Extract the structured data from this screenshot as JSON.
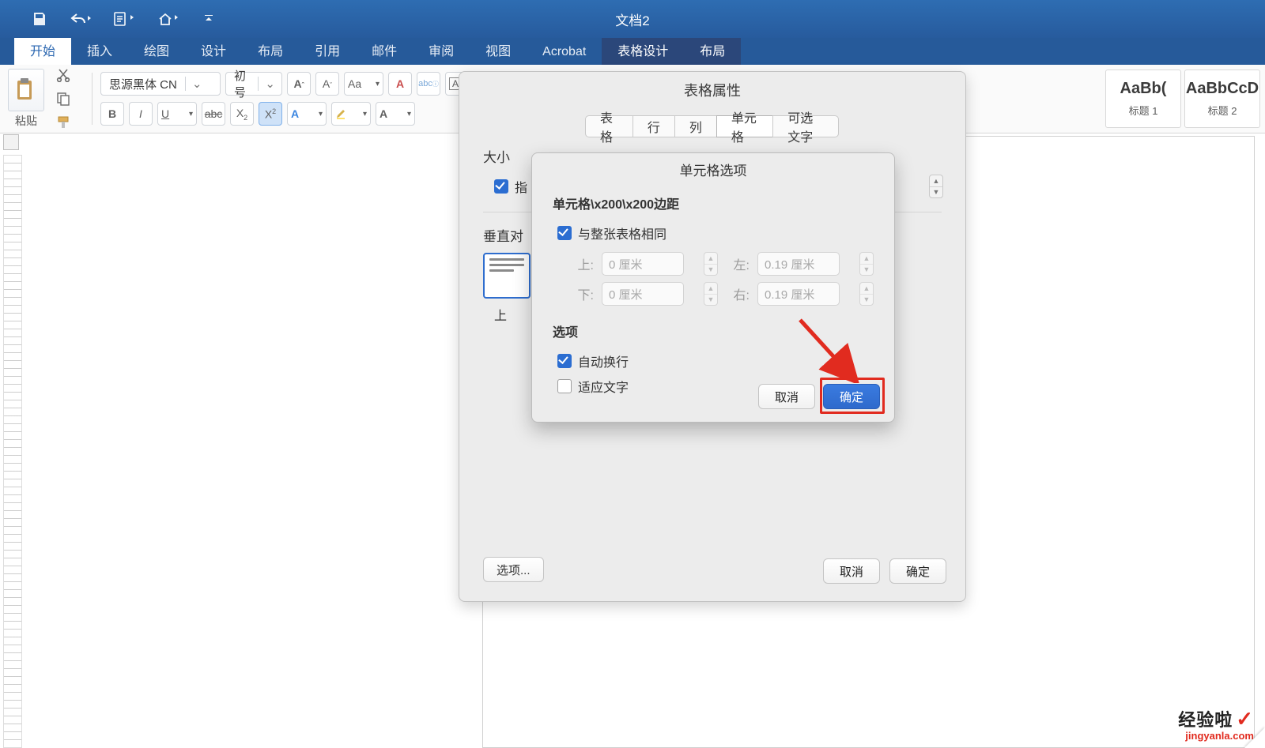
{
  "window": {
    "title": "文档2"
  },
  "qat": {
    "save": "save",
    "undo": "undo",
    "new": "new-doc",
    "home": "home",
    "more": "chevron-down"
  },
  "tabs": {
    "items": [
      {
        "id": "home",
        "label": "开始",
        "active": true
      },
      {
        "id": "insert",
        "label": "插入"
      },
      {
        "id": "draw",
        "label": "绘图"
      },
      {
        "id": "design",
        "label": "设计"
      },
      {
        "id": "layout",
        "label": "布局"
      },
      {
        "id": "references",
        "label": "引用"
      },
      {
        "id": "mail",
        "label": "邮件"
      },
      {
        "id": "review",
        "label": "审阅"
      },
      {
        "id": "view",
        "label": "视图"
      },
      {
        "id": "acrobat",
        "label": "Acrobat"
      },
      {
        "id": "table-design",
        "label": "表格设计",
        "context": true
      },
      {
        "id": "table-layout",
        "label": "布局",
        "context": true
      }
    ]
  },
  "ribbon": {
    "paste_label": "粘贴",
    "font_name": "思源黑体 CN",
    "font_size": "初号",
    "buttons": {
      "bold": "B",
      "italic": "I",
      "underline": "U",
      "strike": "abc",
      "sub": "X",
      "sup": "X",
      "textfx": "A",
      "hl": "hl",
      "color": "A",
      "a_case": "Aa"
    },
    "inc": "A",
    "dec": "A",
    "clear": "A"
  },
  "styles": [
    {
      "preview": "AaBb(",
      "label": "标题 1"
    },
    {
      "preview": "AaBbCcD",
      "label": "标题 2"
    }
  ],
  "tableProps": {
    "title": "表格属性",
    "tabs": [
      {
        "id": "table",
        "label": "表格"
      },
      {
        "id": "row",
        "label": "行"
      },
      {
        "id": "column",
        "label": "列"
      },
      {
        "id": "cell",
        "label": "单元格",
        "selected": true
      },
      {
        "id": "alt",
        "label": "可选文字"
      }
    ],
    "size_label": "大小",
    "preferred_check": "指",
    "valign_label": "垂直对",
    "top_label": "上",
    "options_btn": "选项...",
    "cancel": "取消",
    "ok": "确定"
  },
  "cellOptions": {
    "title": "单元格选项",
    "margins_label": "单元格\\x200\\x200边距",
    "same_as_table": "与整张表格相同",
    "top_lab": "上:",
    "top_val": "0 厘米",
    "bottom_lab": "下:",
    "bottom_val": "0 厘米",
    "left_lab": "左:",
    "left_val": "0.19 厘米",
    "right_lab": "右:",
    "right_val": "0.19 厘米",
    "options_label": "选项",
    "wrap": "自动换行",
    "fit": "适应文字",
    "cancel": "取消",
    "ok": "确定"
  },
  "watermark": {
    "line1": "经验啦",
    "line2": "jingyanla.com"
  }
}
